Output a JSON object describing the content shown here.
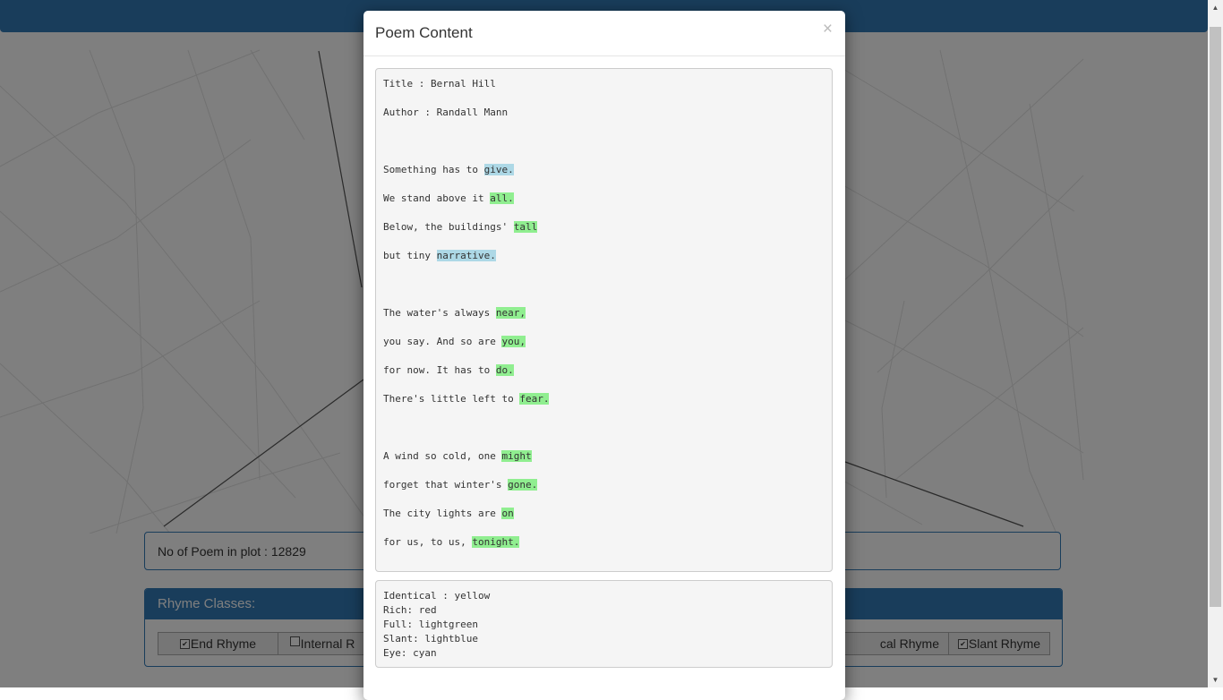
{
  "background": {
    "count_text": "No of Poem in plot : 12829",
    "rhyme_panel": {
      "title": "Rhyme Classes:",
      "buttons": [
        {
          "label": "End Rhyme",
          "checked": true
        },
        {
          "label": "Internal R",
          "checked": false
        },
        {
          "label": "cal Rhyme",
          "checked": false
        },
        {
          "label": "Slant Rhyme",
          "checked": true
        }
      ]
    }
  },
  "modal": {
    "title": "Poem Content",
    "close_label": "×",
    "poem": {
      "lines": [
        {
          "pre": "Title : Bernal Hill",
          "word": "",
          "hl": ""
        },
        {
          "pre": "Author : Randall Mann",
          "word": "",
          "hl": ""
        },
        {
          "pre": "",
          "word": "",
          "hl": ""
        },
        {
          "pre": "Something has to ",
          "word": "give.",
          "hl": "slant"
        },
        {
          "pre": "We stand above it ",
          "word": "all.",
          "hl": "full"
        },
        {
          "pre": "Below, the buildings' ",
          "word": "tall",
          "hl": "full"
        },
        {
          "pre": "but tiny ",
          "word": "narrative.",
          "hl": "slant"
        },
        {
          "pre": "",
          "word": "",
          "hl": ""
        },
        {
          "pre": "The water's always ",
          "word": "near,",
          "hl": "full"
        },
        {
          "pre": "you say. And so are ",
          "word": "you,",
          "hl": "full"
        },
        {
          "pre": "for now. It has to ",
          "word": "do.",
          "hl": "full"
        },
        {
          "pre": "There's little left to ",
          "word": "fear.",
          "hl": "full"
        },
        {
          "pre": "",
          "word": "",
          "hl": ""
        },
        {
          "pre": "A wind so cold, one ",
          "word": "might",
          "hl": "full"
        },
        {
          "pre": "forget that winter's ",
          "word": "gone.",
          "hl": "full"
        },
        {
          "pre": "The city lights are ",
          "word": "on",
          "hl": "full"
        },
        {
          "pre": "for us, to us, ",
          "word": "tonight.",
          "hl": "full"
        }
      ]
    },
    "legend": [
      "Identical : yellow",
      "Rich: red",
      "Full: lightgreen",
      "Slant: lightblue",
      "Eye: cyan"
    ]
  },
  "colors": {
    "primary": "#337ab7",
    "full_rhyme": "lightgreen",
    "slant_rhyme": "lightblue"
  }
}
